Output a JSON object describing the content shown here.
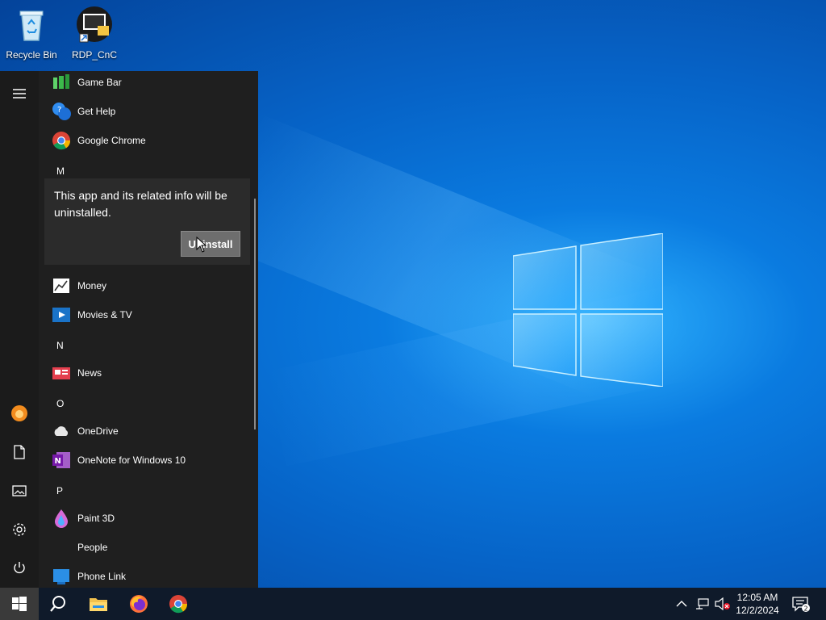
{
  "desktop": {
    "icons": [
      {
        "label": "Recycle Bin"
      },
      {
        "label": "RDP_CnC"
      }
    ]
  },
  "start_menu": {
    "apps": [
      {
        "label": "Game Bar",
        "icon": "game-bar-icon"
      },
      {
        "label": "Get Help",
        "icon": "get-help-icon"
      },
      {
        "label": "Google Chrome",
        "icon": "chrome-icon"
      },
      {
        "label": "Money",
        "icon": "money-icon"
      },
      {
        "label": "Movies & TV",
        "icon": "movies-tv-icon"
      },
      {
        "label": "News",
        "icon": "news-icon"
      },
      {
        "label": "OneDrive",
        "icon": "onedrive-icon"
      },
      {
        "label": "OneNote for Windows 10",
        "icon": "onenote-icon"
      },
      {
        "label": "Paint 3D",
        "icon": "paint3d-icon"
      },
      {
        "label": "People",
        "icon": "people-icon"
      },
      {
        "label": "Phone Link",
        "icon": "phone-link-icon"
      }
    ],
    "letters": [
      "M",
      "N",
      "O",
      "P"
    ],
    "rail": [
      "hamburger-icon",
      "user-avatar-icon",
      "documents-icon",
      "pictures-icon",
      "settings-icon",
      "power-icon"
    ]
  },
  "uninstall_flyout": {
    "message": "This app and its related info will be uninstalled.",
    "button_label": "Uninstall"
  },
  "taskbar": {
    "time": "12:05 AM",
    "date": "12/2/2024",
    "notification_count": "2",
    "pinned": [
      "search-icon",
      "file-explorer-icon",
      "firefox-icon",
      "chrome-icon"
    ]
  },
  "colors": {
    "accent": "#0078d7",
    "start_bg": "#1f1f1f",
    "taskbar_bg": "#0f1a2a"
  }
}
